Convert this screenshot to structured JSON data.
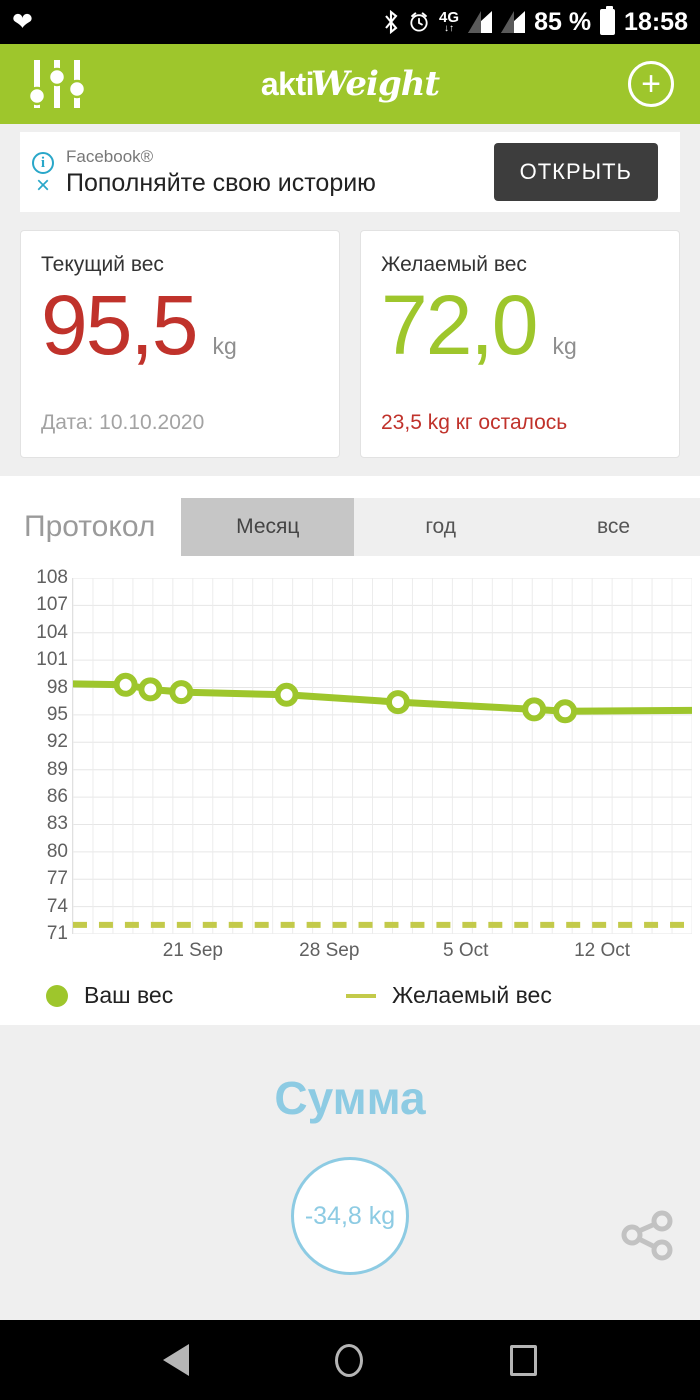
{
  "statusbar": {
    "heart_icon": "heart-icon",
    "bluetooth_icon": "bluetooth-icon",
    "alarm_icon": "alarm-icon",
    "network_label": "4G",
    "network_arrows": "↓↑",
    "battery_percent": "85 %",
    "time": "18:58"
  },
  "appbar": {
    "settings_icon": "sliders-icon",
    "brand_part1": "akti",
    "brand_part2": "Weight",
    "add_label": "+",
    "bg_color": "#9ec62c"
  },
  "ad": {
    "info_icon": "i",
    "close_icon": "×",
    "advertiser": "Facebook®",
    "headline": "Пополняйте свою историю",
    "cta_label": "ОТКРЫТЬ"
  },
  "current_weight_card": {
    "title": "Текущий вес",
    "value": "95,5",
    "unit": "kg",
    "footer": "Дата: 10.10.2020",
    "color": "#c0322b"
  },
  "target_weight_card": {
    "title": "Желаемый вес",
    "value": "72,0",
    "unit": "kg",
    "footer": "23,5 kg кг осталось",
    "color": "#9ec62c"
  },
  "protocol": {
    "title": "Протокол",
    "tabs": [
      {
        "label": "Месяц",
        "active": true
      },
      {
        "label": "год",
        "active": false
      },
      {
        "label": "все",
        "active": false
      }
    ]
  },
  "chart_data": {
    "type": "line",
    "title": "Протокол",
    "xlabel": "",
    "ylabel": "",
    "ylim": [
      71,
      108
    ],
    "ytick_labels": [
      "108",
      "107",
      "104",
      "101",
      "98",
      "95",
      "92",
      "89",
      "86",
      "83",
      "80",
      "77",
      "74",
      "71"
    ],
    "ytick_values": [
      108,
      107,
      104,
      101,
      98,
      95,
      92,
      89,
      86,
      83,
      80,
      77,
      74,
      71
    ],
    "xtick_labels": [
      "21 Sep",
      "28 Sep",
      "5 Oct",
      "12 Oct"
    ],
    "xtick_positions": [
      0.195,
      0.415,
      0.635,
      0.855
    ],
    "grid": true,
    "legend_position": "bottom",
    "series": [
      {
        "name": "Ваш вес",
        "color": "#9ec62c",
        "style": "line-with-markers",
        "x": [
          0.0,
          0.085,
          0.125,
          0.175,
          0.345,
          0.525,
          0.745,
          0.795,
          1.0
        ],
        "values": [
          98.4,
          98.3,
          97.8,
          97.5,
          97.2,
          96.4,
          95.6,
          95.4,
          95.5
        ],
        "marker_x": [
          0.085,
          0.125,
          0.175,
          0.345,
          0.525,
          0.745,
          0.795
        ],
        "marker_values": [
          98.3,
          97.8,
          97.5,
          97.2,
          96.4,
          95.6,
          95.4
        ]
      },
      {
        "name": "Желаемый вес",
        "color": "#c3ca4a",
        "style": "dashed",
        "constant_value": 72.0
      }
    ]
  },
  "legend": {
    "your_weight": "Ваш вес",
    "target_weight": "Желаемый вес"
  },
  "summary": {
    "title": "Сумма",
    "value": "-34,8 kg",
    "color": "#8dcbe3",
    "share_icon": "share-icon"
  },
  "navbar": {
    "back": "back-icon",
    "home": "home-icon",
    "recents": "recents-icon"
  }
}
